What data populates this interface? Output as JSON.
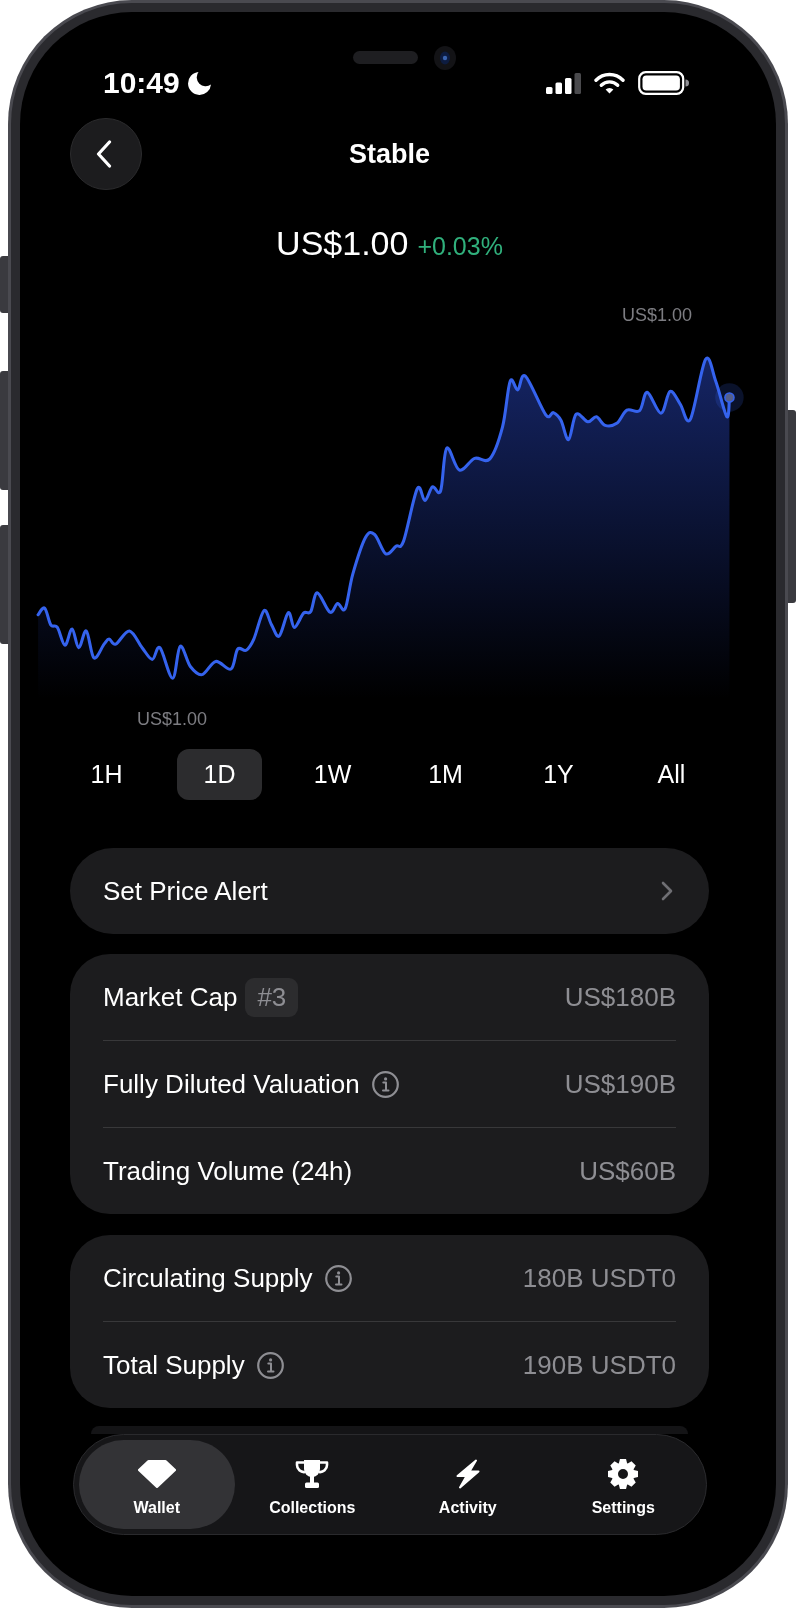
{
  "status_bar": {
    "time": "10:49"
  },
  "header": {
    "title": "Stable"
  },
  "price": {
    "value": "US$1.00",
    "change": "+0.03%"
  },
  "chart": {
    "high_label": "US$1.00",
    "low_label": "US$1.00"
  },
  "ranges": [
    {
      "label": "1H",
      "selected": false
    },
    {
      "label": "1D",
      "selected": true
    },
    {
      "label": "1W",
      "selected": false
    },
    {
      "label": "1M",
      "selected": false
    },
    {
      "label": "1Y",
      "selected": false
    },
    {
      "label": "All",
      "selected": false
    }
  ],
  "price_alert": {
    "label": "Set Price Alert"
  },
  "market_stats": [
    {
      "label": "Market Cap",
      "badge": "#3",
      "info": false,
      "value": "US$180B"
    },
    {
      "label": "Fully Diluted Valuation",
      "info": true,
      "value": "US$190B"
    },
    {
      "label": "Trading Volume (24h)",
      "info": false,
      "value": "US$60B"
    }
  ],
  "supply_stats": [
    {
      "label": "Circulating Supply",
      "info": true,
      "value": "180B USDT0"
    },
    {
      "label": "Total Supply",
      "info": true,
      "value": "190B USDT0"
    }
  ],
  "tab_bar": [
    {
      "label": "Wallet",
      "selected": true
    },
    {
      "label": "Collections",
      "selected": false
    },
    {
      "label": "Activity",
      "selected": false
    },
    {
      "label": "Settings",
      "selected": false
    }
  ]
}
